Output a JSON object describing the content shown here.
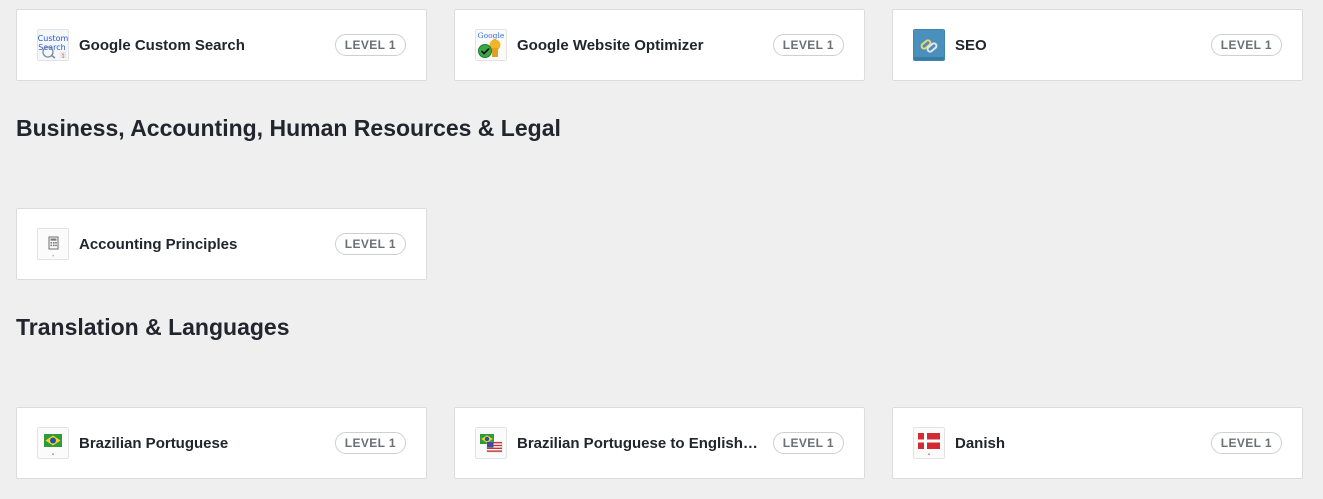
{
  "row1": [
    {
      "title": "Google Custom Search",
      "badge": "LEVEL 1",
      "icon": "google-custom-search-logo-icon"
    },
    {
      "title": "Google Website Optimizer",
      "badge": "LEVEL 1",
      "icon": "google-website-optimizer-logo-icon"
    },
    {
      "title": "SEO",
      "badge": "LEVEL 1",
      "icon": "seo-link-icon"
    }
  ],
  "sections": [
    {
      "heading": "Business, Accounting, Human Resources & Legal",
      "cards": [
        {
          "title": "Accounting Principles",
          "badge": "LEVEL 1",
          "icon": "calculator-icon"
        }
      ]
    },
    {
      "heading": "Translation & Languages",
      "cards": [
        {
          "title": "Brazilian Portuguese",
          "badge": "LEVEL 1",
          "icon": "brazil-flag-icon"
        },
        {
          "title": "Brazilian Portuguese to English Tr...",
          "badge": "LEVEL 1",
          "icon": "brazil-us-flags-icon"
        },
        {
          "title": "Danish",
          "badge": "LEVEL 1",
          "icon": "denmark-flag-icon"
        }
      ]
    }
  ],
  "thumb_texts": {
    "custom_search_line1": "Custom",
    "custom_search_line2": "Search",
    "google_logo": "Google"
  }
}
